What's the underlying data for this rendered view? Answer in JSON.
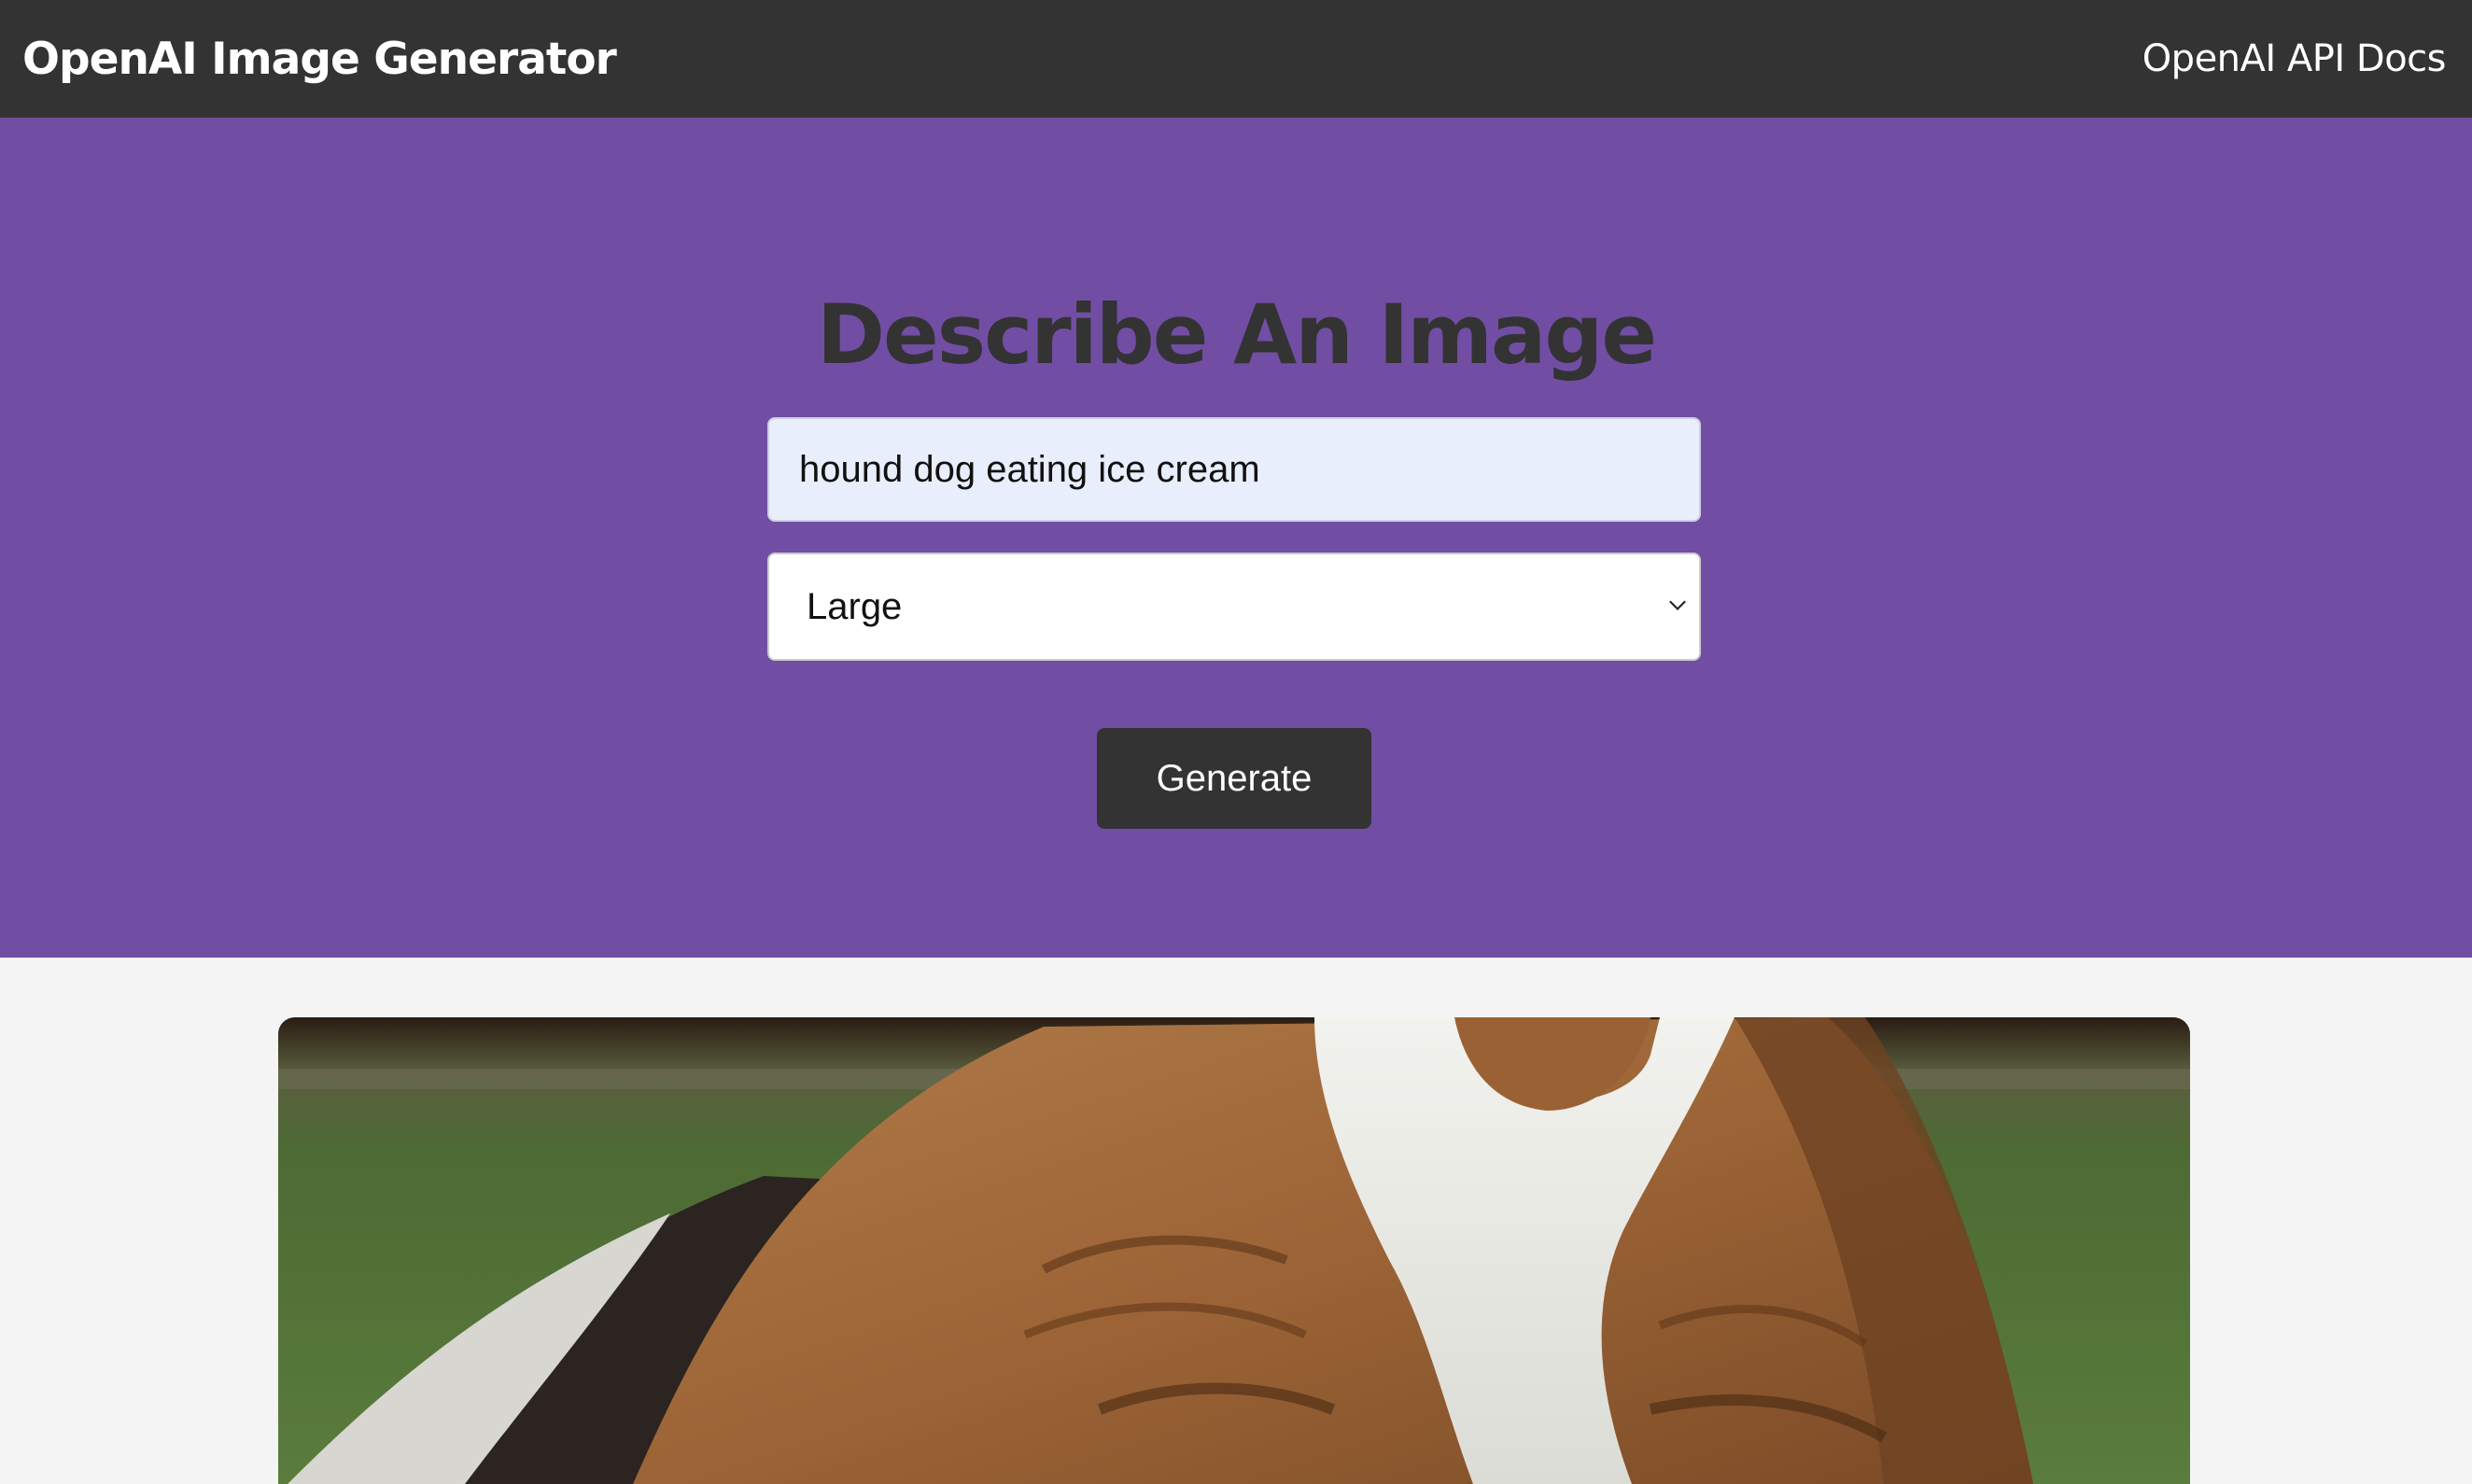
{
  "navbar": {
    "brand": "OpenAI Image Generator",
    "docs_link": "OpenAI API Docs"
  },
  "hero": {
    "title": "Describe An Image",
    "prompt_value": "hound dog eating ice cream",
    "size_selected": "Large",
    "generate_label": "Generate"
  },
  "colors": {
    "navbar_bg": "#333333",
    "hero_bg": "#714ea4",
    "page_bg": "#f4f4f4",
    "input_bg": "#e8eefb"
  },
  "result": {
    "image_subject": "basset hound close-up photo"
  }
}
